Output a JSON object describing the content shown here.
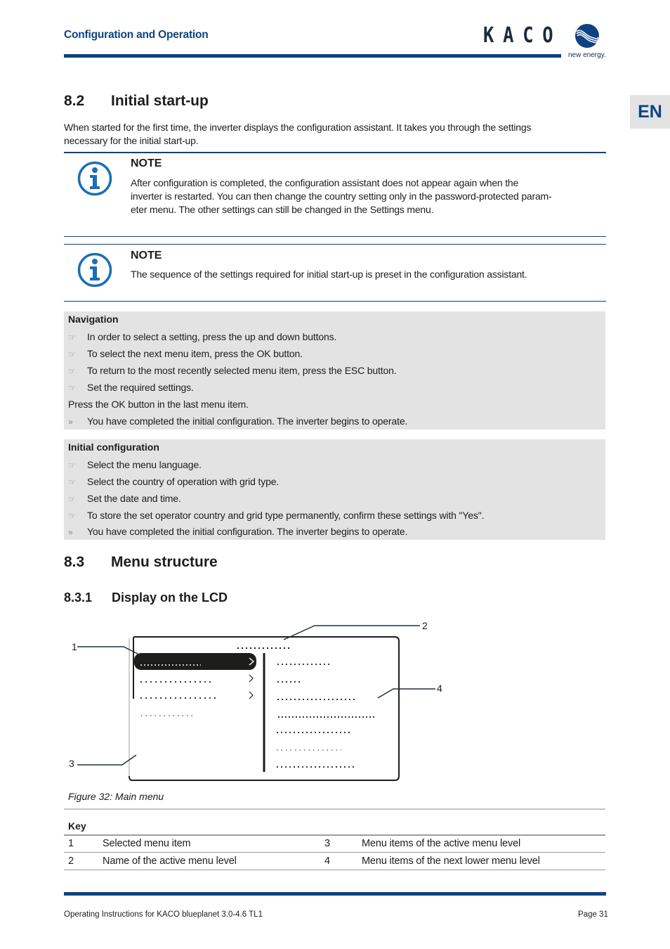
{
  "header": {
    "section_title": "Configuration and Operation",
    "logo_text": "KACO",
    "logo_tagline": "new energy.",
    "language_tab": "EN",
    "brand_color": "#0d4382"
  },
  "section_8_2": {
    "number": "8.2",
    "title": "Initial start-up",
    "intro": "When started for the first time, the inverter displays the configuration assistant. It takes you through the settings necessary for the initial start-up.",
    "intro_lines": [
      "When started for the first time, the inverter displays the configuration assistant. It takes you through the settings",
      "necessary for the initial start-up."
    ],
    "notes": [
      {
        "icon": "info-icon",
        "title": "NOTE",
        "lines": [
          "After configuration is completed, the configuration assistant does not appear again when the",
          "inverter is restarted. You can then change the country setting only in the password-protected param-",
          "eter menu. The other settings can still be changed in the Settings menu."
        ]
      },
      {
        "icon": "info-icon",
        "title": "NOTE",
        "lines": [
          "The sequence of the settings required for initial start-up is preset in the configuration assistant."
        ]
      }
    ],
    "navigation_box": {
      "title": "Navigation",
      "items": [
        {
          "type": "step",
          "symbol": "☞",
          "text": "In order to select a setting, press the up and down buttons."
        },
        {
          "type": "step",
          "symbol": "☞",
          "text": "To select the next menu item, press the OK button."
        },
        {
          "type": "step",
          "symbol": "☞",
          "text": "To return to the most recently selected menu item, press the ESC button."
        },
        {
          "type": "step",
          "symbol": "☞",
          "text": "Set the required settings."
        },
        {
          "type": "plain",
          "symbol": "",
          "text": "Press the OK button in the last menu item."
        },
        {
          "type": "result",
          "symbol": "»",
          "text": "You have completed the initial configuration. The inverter begins to operate."
        }
      ]
    },
    "initial_config_box": {
      "title": "Initial configuration",
      "items": [
        {
          "type": "step",
          "symbol": "☞",
          "text": "Select the menu language."
        },
        {
          "type": "step",
          "symbol": "☞",
          "text": "Select the country of operation with grid type."
        },
        {
          "type": "step",
          "symbol": "☞",
          "text": "Set the date and time."
        },
        {
          "type": "step",
          "symbol": "☞",
          "text": "To store the set operator country and grid type permanently, confirm these settings with \"Yes\"."
        },
        {
          "type": "result",
          "symbol": "»",
          "text": "You have completed the initial configuration. The inverter begins to operate."
        }
      ]
    }
  },
  "section_8_3": {
    "number": "8.3",
    "title": "Menu structure",
    "subsection": {
      "number": "8.3.1",
      "title": "Display on the LCD"
    },
    "figure": {
      "caption": "Figure 32: Main menu",
      "callouts": [
        "1",
        "2",
        "3",
        "4"
      ],
      "active_level_items": 4,
      "items_with_submenu_arrow": 3,
      "selected_item_index": 0,
      "lower_level_items": 7
    },
    "key": {
      "title": "Key",
      "rows": [
        [
          {
            "num": "1",
            "label": "Selected menu item"
          },
          {
            "num": "3",
            "label": "Menu items of the active menu level"
          }
        ],
        [
          {
            "num": "2",
            "label": "Name of the active menu level"
          },
          {
            "num": "4",
            "label": "Menu items of the next lower menu level"
          }
        ]
      ]
    }
  },
  "footer": {
    "document": "Operating Instructions for KACO blueplanet 3.0-4.6 TL1",
    "page": "Page 31"
  }
}
